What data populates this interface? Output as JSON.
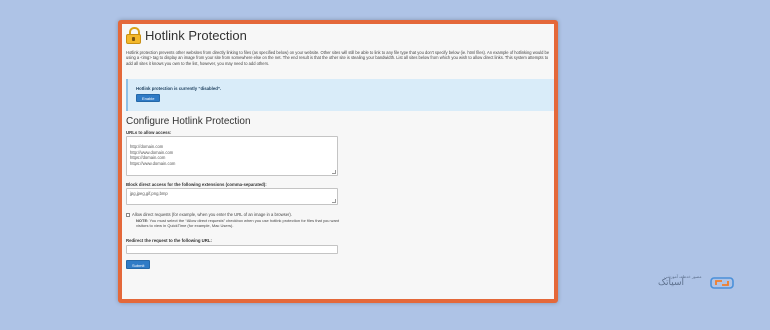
{
  "page": {
    "title": "Hotlink Protection",
    "description": "Hotlink protection prevents other websites from directly linking to files (as specified below) on your website. Other sites will still be able to link to any file type that you don't specify below (ie. html files). An example of hotlinking would be using a <img> tag to display an image from your site from somewhere else on the net. The end result is that the other site is stealing your bandwidth. List all sites below from which you wish to allow direct links. This system attempts to add all sites it knows you own to the list, however, you may need to add others."
  },
  "alert": {
    "status_text": "Hotlink protection is currently “disabled”.",
    "enable_label": "Enable"
  },
  "config": {
    "section_title": "Configure Hotlink Protection",
    "urls_label": "URLs to allow access:",
    "urls_value": "http://domain.com\nhttp://www.domain.com\nhttps://domain.com\nhttps://www.domain.com",
    "extensions_label": "Block direct access for the following extensions (comma-separated):",
    "extensions_value": "jpg,jpeg,gif,png,bmp",
    "allow_direct_label": "Allow direct requests (for example, when you enter the URL of an image in a browser).",
    "allow_direct_checked": false,
    "note_label": "NOTE:",
    "note_text": " You must select the “Allow direct requests” checkbox when you use hotlink protection for files that you want visitors to view in QuickTime (for example, Mac Users).",
    "redirect_label": "Redirect the request to the following URL:",
    "redirect_value": "",
    "submit_label": "Submit"
  },
  "logo": {
    "caption": "مصور خدمات آموزشی",
    "word": "آسیاتک"
  },
  "colors": {
    "frame": "#e4683a",
    "primary_button": "#2f7bc6",
    "alert_bg": "#d9ecf9"
  }
}
